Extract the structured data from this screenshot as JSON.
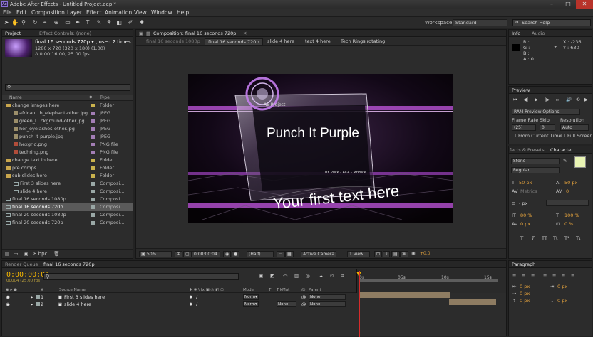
{
  "app": {
    "icon_text": "Ae",
    "title": "Adobe After Effects - Untitled Project.aep *",
    "window_controls": [
      "–",
      "□",
      "✕"
    ]
  },
  "menu": [
    "File",
    "Edit",
    "Composition",
    "Layer",
    "Effect",
    "Animation",
    "View",
    "Window",
    "Help"
  ],
  "workspace": {
    "label": "Workspace:",
    "value": "Standard"
  },
  "search_help": "Search Help",
  "project": {
    "tabs": [
      "Project",
      "Effect Controls: (none)"
    ],
    "selected_name": "final 16 seconds 720p ▾ , used 2 times",
    "meta1": "1280 x 720  (320 x 180) (1.00)",
    "meta2": "Δ 0:00:16:00, 25.00 fps",
    "col_name": "Name",
    "col_type": "Type",
    "items": [
      {
        "name": "change images here",
        "type": "Folder",
        "kind": "folder",
        "indent": 0,
        "label": "#c9b24d"
      },
      {
        "name": "african...h_elephant-other.jpg",
        "type": "JPEG",
        "kind": "image",
        "indent": 1,
        "label": "#a37eb5"
      },
      {
        "name": "green_l...ckground-other.jpg",
        "type": "JPEG",
        "kind": "image",
        "indent": 1,
        "label": "#a37eb5"
      },
      {
        "name": "her_eyelashes-other.jpg",
        "type": "JPEG",
        "kind": "image",
        "indent": 1,
        "label": "#a37eb5"
      },
      {
        "name": "punch-it-purple.jpg",
        "type": "JPEG",
        "kind": "image",
        "indent": 1,
        "label": "#a37eb5"
      },
      {
        "name": "hexgrid.png",
        "type": "PNG file",
        "kind": "png",
        "indent": 1,
        "label": "#a37eb5"
      },
      {
        "name": "techring.png",
        "type": "PNG file",
        "kind": "png",
        "indent": 1,
        "label": "#a37eb5"
      },
      {
        "name": "change text in here",
        "type": "Folder",
        "kind": "folder",
        "indent": 0,
        "label": "#c9b24d"
      },
      {
        "name": "pre comps",
        "type": "Folder",
        "kind": "folder",
        "indent": 0,
        "label": "#c9b24d"
      },
      {
        "name": "sub slides here",
        "type": "Folder",
        "kind": "folder",
        "indent": 0,
        "label": "#c9b24d"
      },
      {
        "name": "First 3 slides here",
        "type": "Composi...",
        "kind": "comp",
        "indent": 1,
        "label": "#9aa8a6"
      },
      {
        "name": "slide 4 here",
        "type": "Composi...",
        "kind": "comp",
        "indent": 1,
        "label": "#9aa8a6"
      },
      {
        "name": "final 16 seconds 1080p",
        "type": "Composi...",
        "kind": "comp",
        "indent": 0,
        "label": "#9aa8a6"
      },
      {
        "name": "final 16 seconds 720p",
        "type": "Composi...",
        "kind": "comp",
        "indent": 0,
        "label": "#9aa8a6",
        "selected": true
      },
      {
        "name": "final 20 seconds 1080p",
        "type": "Composi...",
        "kind": "comp",
        "indent": 0,
        "label": "#9aa8a6"
      },
      {
        "name": "final 20 seconds 720p",
        "type": "Composi...",
        "kind": "comp",
        "indent": 0,
        "label": "#9aa8a6"
      }
    ],
    "bpc": "8 bpc"
  },
  "composition": {
    "tab": "Composition: final 16 seconds 720p",
    "subtabs": [
      "final 16 seconds 1080p",
      "final 16 seconds 720p",
      "slide 4 here",
      "text 4 here",
      "Tech Rings rotating"
    ],
    "frame": {
      "headline": "Punch It Purple",
      "byline": "BY  Puck - AKA - MrPuck",
      "tagline": "Your first text here",
      "corner_text": "AE Project"
    },
    "footer": {
      "zoom": "50%",
      "timecode": "0:00:00:04",
      "resolution": "(Half)",
      "camera": "Active Camera",
      "views": "1 View",
      "exposure": "+0.0"
    }
  },
  "info": {
    "tabs": [
      "Info",
      "Audio"
    ],
    "r": "R :",
    "g": "G :",
    "b": "B :",
    "a": "A : 0",
    "x": "X : -236",
    "y": "Y : 630"
  },
  "preview": {
    "tab": "Preview",
    "ram_options": "RAM Preview Options",
    "frame_rate_label": "Frame Rate",
    "skip_label": "Skip",
    "resolution_label": "Resolution",
    "frame_rate": "(25)",
    "skip": "0",
    "resolution": "Auto",
    "from_current": "From Current Time",
    "full_screen": "Full Screen"
  },
  "character": {
    "tabs": [
      "fects & Presets",
      "Character"
    ],
    "font": "Stone",
    "style": "Regular",
    "size": "50 px",
    "leading": "50 px",
    "kerning": "Metrics",
    "tracking": "0",
    "stroke": "- px",
    "vscale": "80 %",
    "hscale": "100 %",
    "baseline": "0 px",
    "tsume": "0 %",
    "styles": [
      "T",
      "T",
      "TT",
      "Tt",
      "T¹",
      "T₁"
    ],
    "color_fill": "#e9f5b4"
  },
  "paragraph": {
    "tab": "Paragraph",
    "values": [
      "0 px",
      "0 px",
      "0 px",
      "0 px",
      "0 px"
    ]
  },
  "timeline": {
    "tabs": [
      "Render Queue",
      "final 16 seconds 720p"
    ],
    "time": "0:00:00:04",
    "fps": "00004 (25.00 fps)",
    "header": {
      "num": "#",
      "source": "Source Name",
      "mode": "Mode",
      "t": "T",
      "trkmat": "TrkMat",
      "parent": "Parent"
    },
    "ticks": [
      "0s",
      "05s",
      "10s",
      "15s"
    ],
    "layers": [
      {
        "num": "1",
        "name": "First 3 slides here",
        "mode": "Norm▾",
        "trkmat": "",
        "parent": "None"
      },
      {
        "num": "2",
        "name": "slide 4 here",
        "mode": "Norm▾",
        "trkmat": "None",
        "parent": "None"
      }
    ]
  },
  "colors": {
    "accent": "#f2b400",
    "cti": "#d62b2b",
    "selection": "#5a5a5a"
  }
}
